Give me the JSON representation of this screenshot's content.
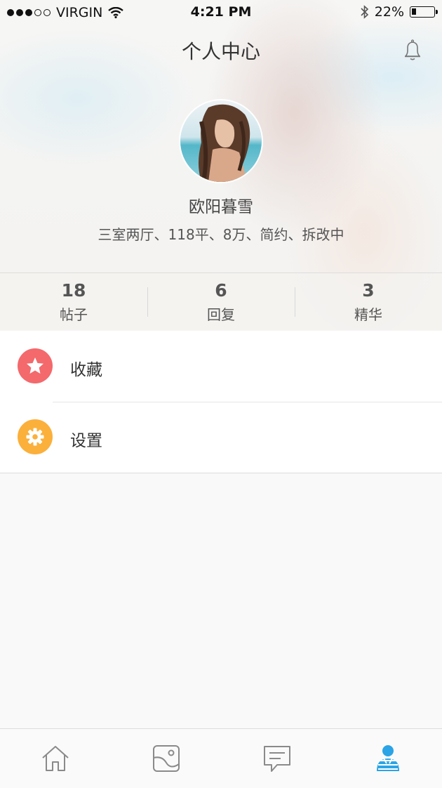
{
  "status_bar": {
    "carrier": "VIRGIN",
    "time": "4:21 PM",
    "battery": "22%",
    "battery_level": 0.22,
    "signal_bars": 3
  },
  "header": {
    "title": "个人中心",
    "bell_icon": "bell-icon"
  },
  "profile": {
    "name": "欧阳暮雪",
    "description": "三室两厅、118平、8万、简约、拆改中"
  },
  "stats": [
    {
      "value": "18",
      "label": "帖子"
    },
    {
      "value": "6",
      "label": "回复"
    },
    {
      "value": "3",
      "label": "精华"
    }
  ],
  "menu": [
    {
      "label": "收藏",
      "icon": "star-icon",
      "color": "#f3696c"
    },
    {
      "label": "设置",
      "icon": "gear-icon",
      "color": "#fbb03b"
    }
  ],
  "tabbar": {
    "items": [
      {
        "icon": "home-icon",
        "active": false
      },
      {
        "icon": "gallery-icon",
        "active": false
      },
      {
        "icon": "message-icon",
        "active": false
      },
      {
        "icon": "profile-icon",
        "active": true
      }
    ],
    "active_color": "#2aa4e6",
    "inactive_color": "#8a8a8a"
  }
}
